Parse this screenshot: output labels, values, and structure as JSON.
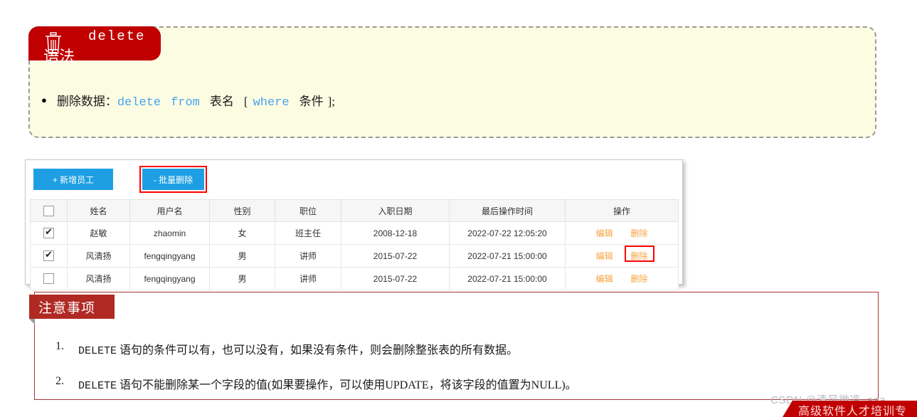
{
  "syntax_card": {
    "tab_title": "delete",
    "tab_subtitle": "语法",
    "icon": "trash-icon",
    "bullet_marker": "●",
    "statement": {
      "label": "删除数据：",
      "kw_delete": "delete",
      "kw_from": "from",
      "table_name": "表名",
      "bracket_open": "[",
      "kw_where": "where",
      "condition": "条件",
      "bracket_close": "];"
    }
  },
  "employee_panel": {
    "toolbar": {
      "add_label": "+ 新增员工",
      "batch_delete_label": "- 批量删除",
      "accent_color": "#1e9fe3",
      "highlight_color": "#ff0000"
    },
    "table": {
      "headers": [
        "",
        "姓名",
        "用户名",
        "性别",
        "职位",
        "入职日期",
        "最后操作时间",
        "操作"
      ],
      "action_labels": {
        "edit": "编辑",
        "delete": "删除"
      },
      "action_color": "#f6a33c",
      "rows": [
        {
          "checked": true,
          "name": "赵敏",
          "username": "zhaomin",
          "gender": "女",
          "position": "班主任",
          "hire_date": "2008-12-18",
          "last_operation": "2022-07-22 12:05:20",
          "delete_highlighted": false
        },
        {
          "checked": true,
          "name": "风清扬",
          "username": "fengqingyang",
          "gender": "男",
          "position": "讲师",
          "hire_date": "2015-07-22",
          "last_operation": "2022-07-21 15:00:00",
          "delete_highlighted": true
        },
        {
          "checked": false,
          "name": "风清扬",
          "username": "fengqingyang",
          "gender": "男",
          "position": "讲师",
          "hire_date": "2015-07-22",
          "last_operation": "2022-07-21 15:00:00",
          "delete_highlighted": false
        }
      ]
    }
  },
  "notes": {
    "tab_label": "注意事项",
    "items": [
      {
        "num": "1.",
        "text_prefix": "DELETE",
        "text": " 语句的条件可以有，也可以没有，如果没有条件，则会删除整张表的所有数据。"
      },
      {
        "num": "2.",
        "text_prefix": "DELETE",
        "text": " 语句不能删除某一个字段的值(如果要操作，可以使用UPDATE，将该字段的值置为NULL)。"
      }
    ]
  },
  "footer": {
    "watermark": "CSDN @清风微凉_aaa",
    "banner_text": "高级软件人才培训专"
  }
}
